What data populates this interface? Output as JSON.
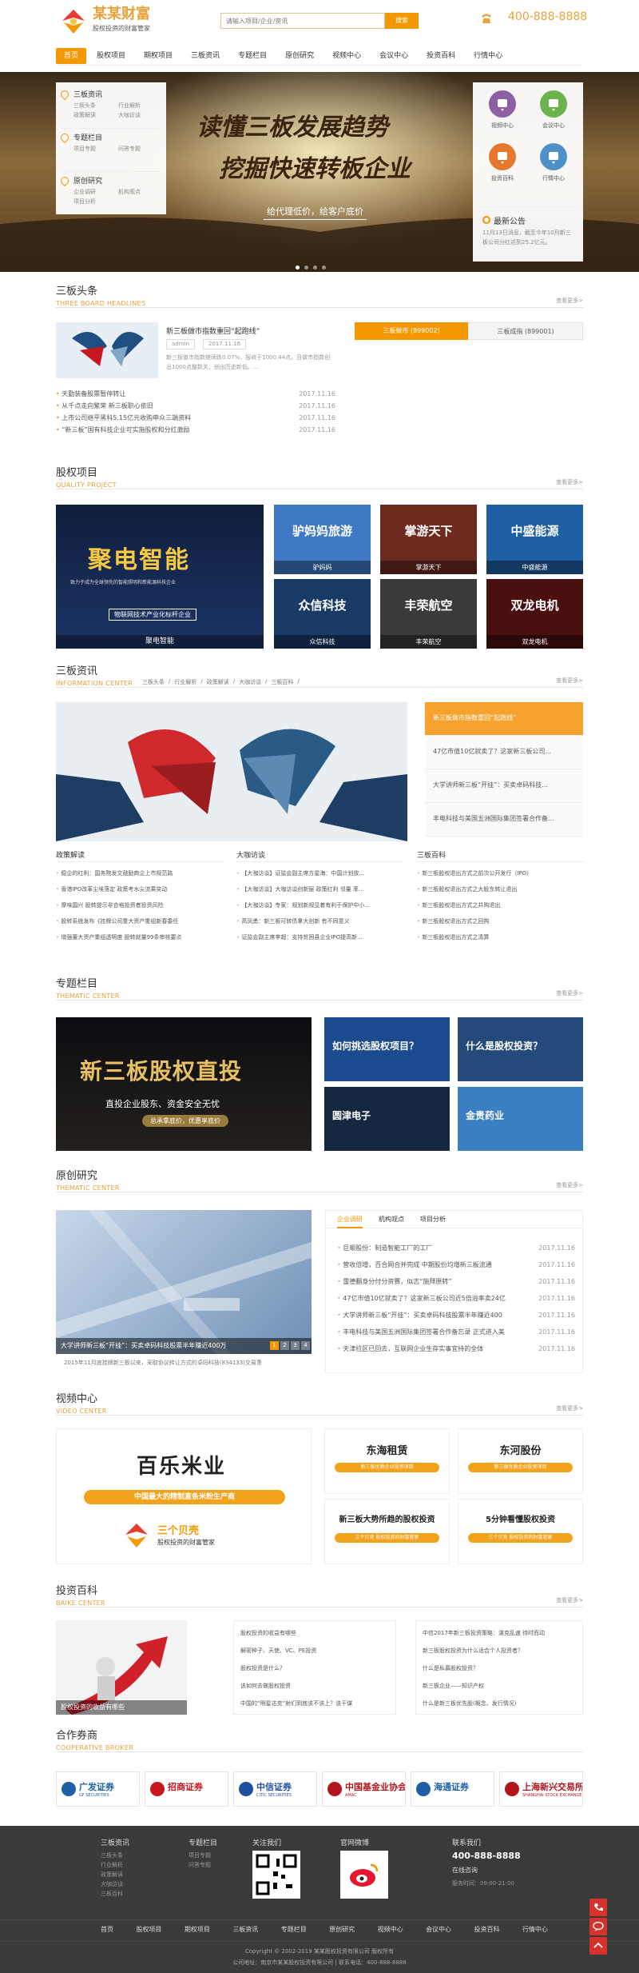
{
  "header": {
    "logo_name": "某某财富",
    "logo_slogan": "股权投资的财富管家",
    "search_placeholder": "请输入项目/企业/资讯",
    "search_button": "搜索",
    "phone": "400-888-8888"
  },
  "nav": {
    "items": [
      "首页",
      "股权项目",
      "期权项目",
      "三板资讯",
      "专题栏目",
      "原创研究",
      "视频中心",
      "会议中心",
      "投资百科",
      "行情中心"
    ],
    "active_index": 0
  },
  "banner": {
    "headline1": "读懂三板发展趋势",
    "headline2": "挖掘快速转板企业",
    "tagline": "给代理低价，给客户底价",
    "side_menu": [
      {
        "title": "三板资讯",
        "links": [
          "三板头条",
          "行业解析",
          "政策解读",
          "大咖访谈"
        ]
      },
      {
        "title": "专题栏目",
        "links": [
          "项目专题",
          "问答专题"
        ]
      },
      {
        "title": "原创研究",
        "links": [
          "企业调研",
          "机构观点",
          "项目分析"
        ]
      }
    ],
    "quick_links": [
      {
        "label": "视频中心",
        "color": "#8e5fa3"
      },
      {
        "label": "会议中心",
        "color": "#6bb34c"
      },
      {
        "label": "投资百科",
        "color": "#e8772e"
      },
      {
        "label": "行情中心",
        "color": "#4e90c7"
      }
    ],
    "notice_title": "最新公告",
    "notice_text": "11月13日消息，截至今年10月新三板公司分红达到25.2亿元。",
    "slide_count": 4
  },
  "headlines": {
    "title": "三板头条",
    "subtitle": "THREE BOARD HEADLINES",
    "more": "查看更多>",
    "featured_title": "新三板做市指数重回“起跑线”",
    "featured_author": "admin",
    "featured_date": "2017.11.16",
    "featured_summary": "新三板做市指数继续跌0.07%，报收于1000.44点。且做市指数创出1000点整数关，创出历史新低。...",
    "list": [
      {
        "text": "天勤装备股票暂停转让",
        "date": "2017.11.16"
      },
      {
        "text": "从千点走向繁荣 新三板职心依旧",
        "date": "2017.11.16"
      },
      {
        "text": "上市公司继平黑科5.15亿元收购申众三端资料",
        "date": "2017.11.16"
      },
      {
        "text": "“新三板”国有科技企业可实施股权和分红激励",
        "date": "2017.11.16"
      }
    ],
    "index_tabs": [
      "三板做市 (899002)",
      "三板成指 (899001)"
    ]
  },
  "equity": {
    "title": "股权项目",
    "subtitle": "QUALITY PROJECT",
    "more": "查看更多>",
    "big_name": "聚电智能",
    "big_caption": "聚电智能",
    "big_line1": "致力于成为全球领先的智能照明和新能源科技企业",
    "big_line2": "物联网技术产业化标杆企业",
    "items": [
      {
        "name": "驴妈妈旅游",
        "caption": "驴妈妈",
        "bg": "#3f79c5"
      },
      {
        "name": "掌游天下",
        "caption": "掌游天下",
        "bg": "#6d2b20"
      },
      {
        "name": "中盛能源",
        "caption": "中盛能源",
        "bg": "#1f5fa3"
      },
      {
        "name": "众信科技",
        "caption": "众信科技",
        "bg": "#183a66"
      },
      {
        "name": "丰荣航空",
        "caption": "丰荣航空",
        "bg": "#3a3a3a"
      },
      {
        "name": "双龙电机",
        "caption": "双龙电机",
        "bg": "#4a1010"
      }
    ]
  },
  "news": {
    "title": "三板资讯",
    "subtitle": "INFORMATION CENTER",
    "more": "查看更多>",
    "sub_tabs": [
      "三板头条",
      "行业解析",
      "政策解读",
      "大咖访谈",
      "三板百科"
    ],
    "side_list": [
      "新三板做市指数重回“起跑线”",
      "47亿市值10亿就卖了？这家新三板公司...",
      "大学讲师新三板“开挂”：买卖卓码科技...",
      "丰电科技与美国五洲国际集团签署合作备..."
    ],
    "columns": [
      {
        "title": "政策解读",
        "items": [
          "稳企的红利：国务院发文鼓励商企上市规范路",
          "香港IPO改革尘埃落定 政策考水尖流乘突动",
          "摩味国兴 股转提示非合格投资者投资风险",
          "股转系统发布《挂牌公司重大资产重组新春委任",
          "增强董大资产重组透明度 股转就量99条审核要点"
        ]
      },
      {
        "title": "大咖访谈",
        "items": [
          "【大咖访谈】证监会副主席方星海：中国计划放...",
          "【大咖访谈】大咖访谈创新层 政策红利 邻量 率...",
          "【大咖访谈】专家：规划新规显着有利于保护中小...",
          "高凤勇：新三板可转债拿大创新 有不同意义",
          "证监会副主席李超：支持贫困县企业IPO提高新..."
        ]
      },
      {
        "title": "三板百科",
        "items": [
          "新三板股权退出方式之前次公开发行（IPO）",
          "新三板股权退出方式之大股东转让退出",
          "新三板股权退出方式之并购退出",
          "新三板股权退出方式之回购",
          "新三板股权退出方式之清算"
        ]
      }
    ]
  },
  "thematic": {
    "title": "专题栏目",
    "subtitle": "THEMATIC CENTER",
    "more": "查看更多>",
    "big_title": "新三板股权直投",
    "big_sub": "直投企业股东、资金安全无忧",
    "big_tag": "总承拿底价，优惠享底价",
    "items": [
      {
        "text": "如何挑选股权项目？",
        "bg": "#1c4a8f"
      },
      {
        "text": "什么是股权投资？",
        "bg": "#234a7a"
      },
      {
        "text": "圆津电子",
        "bg": "#152840"
      },
      {
        "text": "金贵药业",
        "bg": "#3a7ec3"
      }
    ]
  },
  "research": {
    "title": "原创研究",
    "subtitle": "THEMATIC CENTER",
    "more": "查看更多>",
    "tabs": [
      "企业调研",
      "机构观点",
      "项目分析"
    ],
    "caption": "大学讲师新三板“开挂”：买卖卓码科技股票半年赚近400万",
    "slider_pages": [
      "1",
      "2",
      "3",
      "4"
    ],
    "summary": "2015年11月底挂牌新三板以来，采取协议转让方式的卓码科技(834133)交易萧",
    "list": [
      {
        "text": "巨顺股份：制造智能工厂的工厂",
        "date": "2017.11.16"
      },
      {
        "text": "营收倍增，百合网合并完成 中期股份均增新三板流通",
        "date": "2017.11.16"
      },
      {
        "text": "雷德翻身分付分资赛，似志“施拜原转”",
        "date": "2017.11.16"
      },
      {
        "text": "47亿市值10亿就卖了？这家新三板公司近5倍溢率卖24亿",
        "date": "2017.11.16"
      },
      {
        "text": "大学讲师新三板“开挂”：买卖卓码科技股票半年赚近400",
        "date": "2017.11.16"
      },
      {
        "text": "丰电科技与美国五洲国际集团签署合作备忘录 正式进入美",
        "date": "2017.11.16"
      },
      {
        "text": "天津拉区已回去，互联网企业生存实事宜持的全体",
        "date": "2017.11.16"
      }
    ]
  },
  "video": {
    "title": "视频中心",
    "subtitle": "VIDEO CENTER",
    "more": "查看更多>",
    "big_name": "百乐米业",
    "big_sub": "中国最大的精制直条米粉生产商",
    "brand_name": "三个贝壳",
    "brand_slogan": "股权投资的财富管家",
    "items": [
      {
        "name": "东海租赁",
        "sub": "新三板优质企业投资项目"
      },
      {
        "name": "东河股份",
        "sub": "新三板优质企业投资项目"
      },
      {
        "name": "新三板大势所趋的股权投资",
        "sub": "三个贝壳 股权投资的财富管家"
      },
      {
        "name": "5分钟看懂股权投资",
        "sub": "三个贝壳 股权投资的财富管家"
      }
    ]
  },
  "baike": {
    "title": "投资百科",
    "subtitle": "BAIKE CENTER",
    "more": "查看更多>",
    "image_caption": "股权投资的收益有哪些",
    "col1": [
      "股权投资的收益有哪些",
      "解密种子、天使、VC、PE投资",
      "股权投资是什么？",
      "该如何去做股权投资",
      "中国的“明星达克”射们到底该不该上？该干谋"
    ],
    "col2": [
      "中信2017年新三板投资策略：湛克乱速 待时而动",
      "新三板股权投资为什么适合个人投资者？",
      "什么是私募股权投资？",
      "新三板企业——知识产权",
      "什么是新三板优先股(概念、发行情况)"
    ]
  },
  "partners": {
    "title": "合作券商",
    "subtitle": "COOPERATIVE BROKER",
    "items": [
      {
        "name": "广发证券",
        "en": "GF SECURITIES",
        "color": "#1f5fa8"
      },
      {
        "name": "招商证券",
        "en": "",
        "color": "#c8171e"
      },
      {
        "name": "中信证券",
        "en": "CITIC SECURITIES",
        "color": "#1f4fa0"
      },
      {
        "name": "中国基金业协会",
        "en": "AMAC",
        "color": "#b0161c"
      },
      {
        "name": "海通证券",
        "en": "",
        "color": "#1f5fa8"
      },
      {
        "name": "上海新兴交易所",
        "en": "SHANGHAI STOCK EXCHANGE",
        "color": "#b0161c"
      }
    ]
  },
  "footer": {
    "cols": [
      {
        "title": "三板资讯",
        "links": [
          "三板头条",
          "行业解析",
          "政策解读",
          "大咖访谈",
          "三板百科"
        ]
      },
      {
        "title": "专题栏目",
        "links": [
          "项目专题",
          "问答专题"
        ]
      },
      {
        "title": "关注我们",
        "links": []
      },
      {
        "title": "官网微博",
        "links": []
      },
      {
        "title": "联系我们",
        "links": []
      }
    ],
    "phone": "400-888-8888",
    "online_label": "在线咨询",
    "hours_label": "服务时间：",
    "hours": "09:00-21:00",
    "nav": [
      "首页",
      "股权项目",
      "期权项目",
      "三板资讯",
      "专题栏目",
      "原创研究",
      "视频中心",
      "会议中心",
      "投资百科",
      "行情中心"
    ],
    "copyright": "Copyright © 2002-2019 某某股权投资有限公司 版权所有",
    "contact_line": "公司地址：南京市某某股权投资有限公司 | 联系电话：400-888-8888"
  },
  "colors": {
    "accent": "#f39800",
    "footer_bg": "#3a3a3a",
    "float_red": "#d6322c"
  }
}
